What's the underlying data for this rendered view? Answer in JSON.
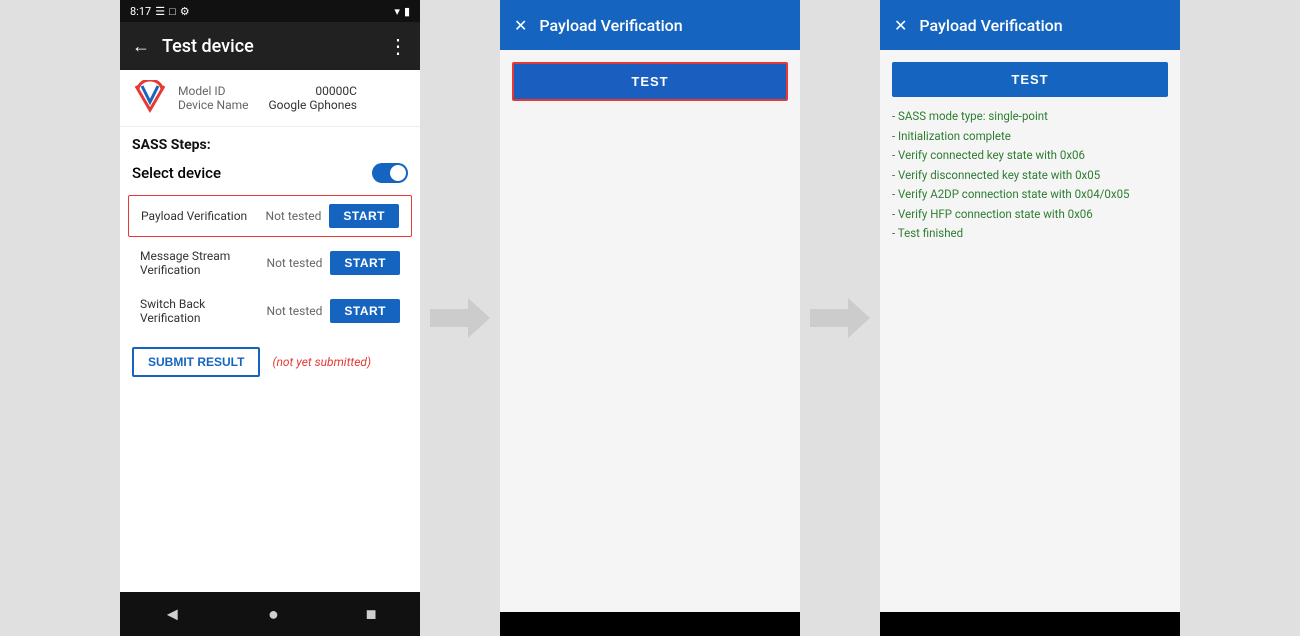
{
  "statusBar": {
    "time": "8:17",
    "icons": [
      "sim",
      "wifi",
      "battery"
    ]
  },
  "appBar": {
    "title": "Test device",
    "backIcon": "←",
    "menuIcon": "⋮"
  },
  "deviceInfo": {
    "modelIdLabel": "Model ID",
    "modelIdValue": "00000C",
    "deviceNameLabel": "Device Name",
    "deviceNameValue": "Google Gphones"
  },
  "sassStepsLabel": "SASS Steps:",
  "selectDeviceLabel": "Select device",
  "testRows": [
    {
      "name": "Payload Verification",
      "status": "Not tested",
      "buttonLabel": "START",
      "highlighted": true
    },
    {
      "name": "Message Stream Verification",
      "status": "Not tested",
      "buttonLabel": "START",
      "highlighted": false
    },
    {
      "name": "Switch Back Verification",
      "status": "Not tested",
      "buttonLabel": "START",
      "highlighted": false
    }
  ],
  "submitButton": "SUBMIT RESULT",
  "submitStatus": "(not yet submitted)",
  "navIcons": [
    "◄",
    "●",
    "■"
  ],
  "dialog1": {
    "closeIcon": "✕",
    "title": "Payload Verification",
    "testButtonLabel": "TEST",
    "hasOutline": true
  },
  "dialog2": {
    "closeIcon": "✕",
    "title": "Payload Verification",
    "testButtonLabel": "TEST",
    "hasOutline": false,
    "results": [
      "- SASS mode type: single-point",
      "- Initialization complete",
      "- Verify connected key state with 0x06",
      "- Verify disconnected key state with 0x05",
      "- Verify A2DP connection state with 0x04/0x05",
      "- Verify HFP connection state with 0x06",
      "- Test finished"
    ]
  },
  "testedLabel": "tested"
}
